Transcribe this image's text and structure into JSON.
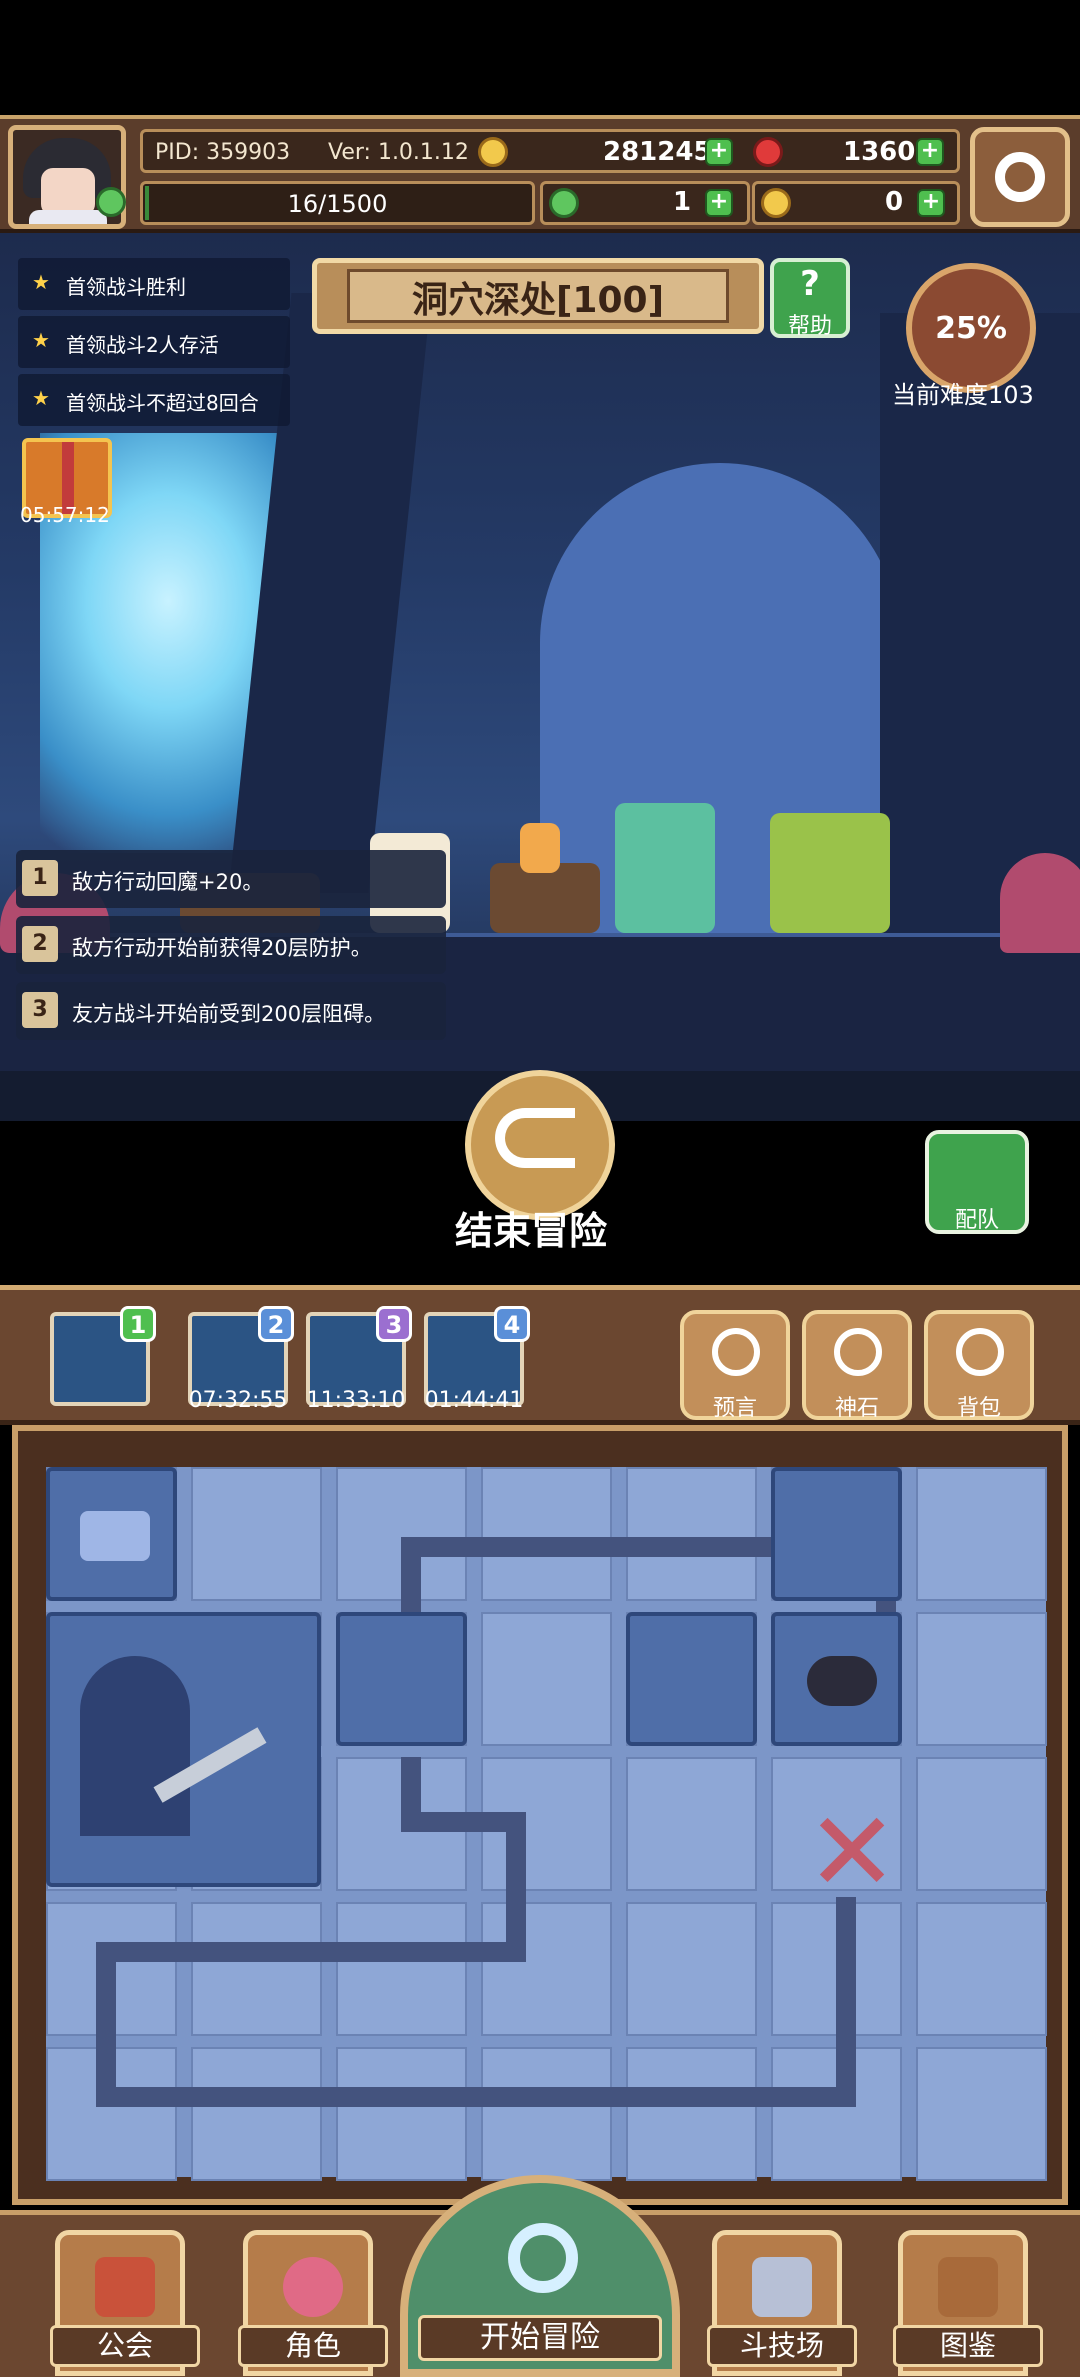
{
  "hud": {
    "pid": "PID: 359903",
    "version": "Ver: 1.0.1.12",
    "gold": "281245",
    "gems": "1360",
    "stamina": "16/1500",
    "stamina_fraction": 0.0107,
    "clover": "1",
    "key": "0"
  },
  "scene": {
    "stage_title": "洞穴深处[100]",
    "help_label": "帮助",
    "progress": "25%",
    "difficulty": "当前难度103",
    "quests": [
      "首领战斗胜利",
      "首领战斗2人存活",
      "首领战斗不超过8回合"
    ],
    "gift_timer": "05:57:12",
    "effects": [
      {
        "n": "1",
        "text": "敌方行动回魔+20。"
      },
      {
        "n": "2",
        "text": "敌方行动开始前获得20层防护。"
      },
      {
        "n": "3",
        "text": "友方战斗开始前受到200层阻碍。"
      }
    ],
    "end_label": "结束冒险",
    "team_label": "配队"
  },
  "items": {
    "slots": [
      {
        "badge": "1",
        "timer": "",
        "color": "#4fbf4f"
      },
      {
        "badge": "2",
        "timer": "07:32:55",
        "color": "#5a8fd8"
      },
      {
        "badge": "3",
        "timer": "11:33:10",
        "color": "#9b6fd0"
      },
      {
        "badge": "4",
        "timer": "01:44:41",
        "color": "#5a8fd8"
      }
    ],
    "prophecy": "预言",
    "godstone": "神石",
    "bag": "背包"
  },
  "nav": {
    "guild": "公会",
    "character": "角色",
    "adventure": "开始冒险",
    "arena": "斗技场",
    "codex": "图鉴"
  }
}
